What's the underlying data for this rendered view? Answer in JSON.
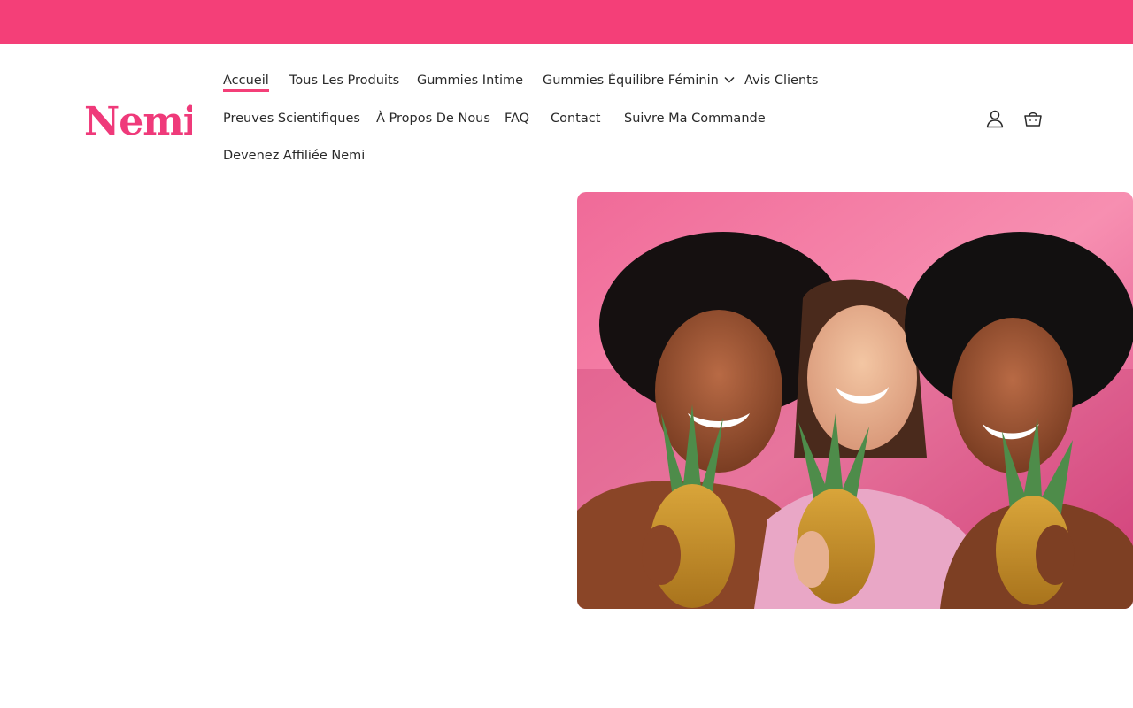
{
  "brand": {
    "name": "Nemi",
    "color": "#f43f78"
  },
  "nav": {
    "accueil": "Accueil",
    "tous_produits": "Tous Les Produits",
    "gummies_intime": "Gummies Intime",
    "gummies_equilibre": "Gummies Équilibre Féminin",
    "avis_clients": "Avis Clients",
    "preuves": "Preuves Scientifiques",
    "a_propos": "À Propos De Nous",
    "faq": "FAQ",
    "contact": "Contact",
    "suivre": "Suivre Ma Commande",
    "affiliee": "Devenez Affiliée Nemi",
    "active": "Accueil"
  },
  "icons": {
    "account": "user-icon",
    "cart": "basket-icon",
    "dropdown": "chevron-down-icon"
  },
  "hero": {
    "image": "three-women-holding-pineapples-on-pink-background"
  }
}
